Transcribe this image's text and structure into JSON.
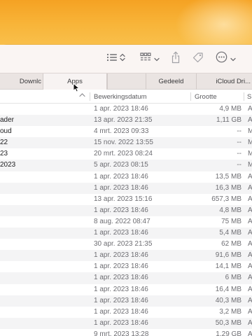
{
  "toolbar": {
    "list_view_icon": "list-view-icon",
    "sort_icon": "up-down-chevron-icon",
    "group_icon": "grid-group-icon",
    "share_icon": "share-icon",
    "tag_icon": "tag-icon",
    "more_icon": "ellipsis-circle-icon"
  },
  "tabs": [
    {
      "label": "Downlc"
    },
    {
      "label": "Apps"
    },
    {
      "label": ""
    },
    {
      "label": "Gedeeld"
    },
    {
      "label": "iCloud Dri..."
    }
  ],
  "columns": {
    "name": "",
    "date": "Bewerkingsdatum",
    "size": "Grootte",
    "kind": "S"
  },
  "rows": [
    {
      "name": "",
      "date": "1 apr. 2023 18:46",
      "size": "4,9 MB",
      "kind": "A"
    },
    {
      "name": "ader",
      "date": "13 apr. 2023 21:35",
      "size": "1,11 GB",
      "kind": "A"
    },
    {
      "name": "oud",
      "date": "4 mrt. 2023 09:33",
      "size": "--",
      "kind": "M"
    },
    {
      "name": "22",
      "date": "15 nov. 2022 13:55",
      "size": "--",
      "kind": "M"
    },
    {
      "name": "23",
      "date": "20 mrt. 2023 08:24",
      "size": "--",
      "kind": "M"
    },
    {
      "name": "2023",
      "date": "5 apr. 2023 08:15",
      "size": "--",
      "kind": "M"
    },
    {
      "name": "",
      "date": "1 apr. 2023 18:46",
      "size": "13,5 MB",
      "kind": "A"
    },
    {
      "name": "",
      "date": "1 apr. 2023 18:46",
      "size": "16,3 MB",
      "kind": "A"
    },
    {
      "name": "",
      "date": "13 apr. 2023 15:16",
      "size": "657,3 MB",
      "kind": "A"
    },
    {
      "name": "",
      "date": "1 apr. 2023 18:46",
      "size": "4,8 MB",
      "kind": "A"
    },
    {
      "name": "",
      "date": "8 aug. 2022 08:47",
      "size": "75 MB",
      "kind": "A"
    },
    {
      "name": "",
      "date": "1 apr. 2023 18:46",
      "size": "5,4 MB",
      "kind": "A"
    },
    {
      "name": "",
      "date": "30 apr. 2023 21:35",
      "size": "62 MB",
      "kind": "A"
    },
    {
      "name": "",
      "date": "1 apr. 2023 18:46",
      "size": "91,6 MB",
      "kind": "A"
    },
    {
      "name": "",
      "date": "1 apr. 2023 18:46",
      "size": "14,1 MB",
      "kind": "A"
    },
    {
      "name": "",
      "date": "1 apr. 2023 18:46",
      "size": "6 MB",
      "kind": "A"
    },
    {
      "name": "",
      "date": "1 apr. 2023 18:46",
      "size": "16,4 MB",
      "kind": "A"
    },
    {
      "name": "",
      "date": "1 apr. 2023 18:46",
      "size": "40,3 MB",
      "kind": "A"
    },
    {
      "name": "",
      "date": "1 apr. 2023 18:46",
      "size": "3,2 MB",
      "kind": "A"
    },
    {
      "name": "",
      "date": "1 apr. 2023 18:46",
      "size": "50,3 MB",
      "kind": "A"
    },
    {
      "name": "",
      "date": "9 mrt. 2023 13:28",
      "size": "1,29 GB",
      "kind": "A"
    }
  ],
  "colors": {
    "desktop": "#f5a223",
    "toolbar": "#faf5f3",
    "tabbar": "#eae4e2",
    "row_alt": "#f4f4f5"
  }
}
